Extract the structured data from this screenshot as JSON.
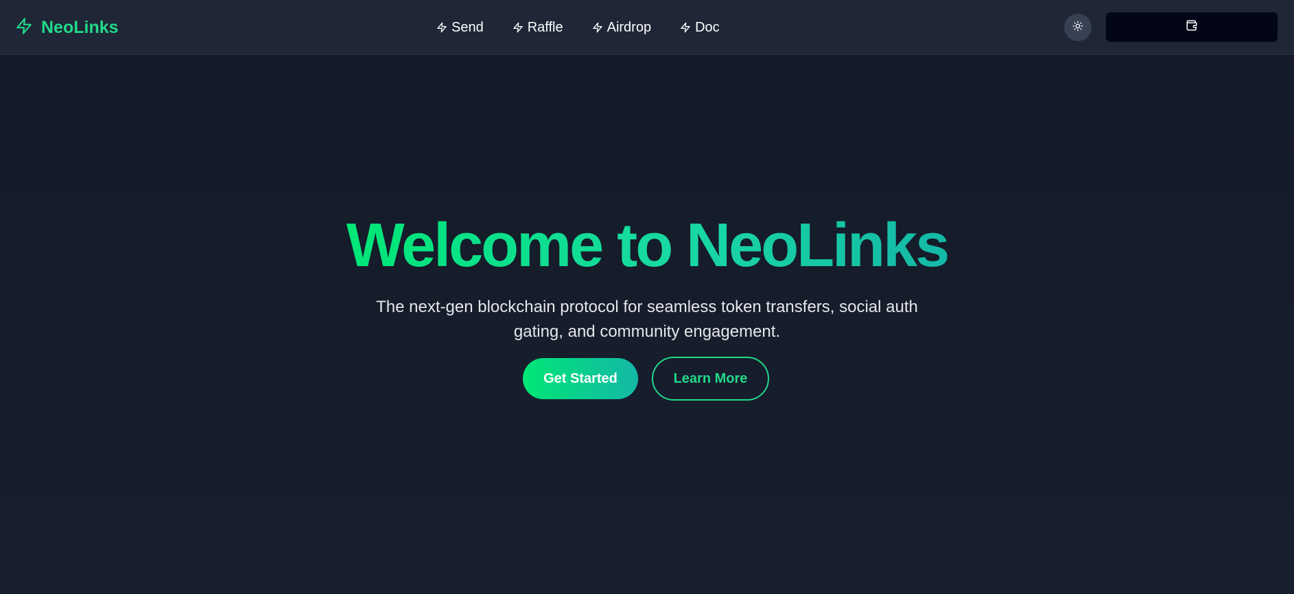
{
  "header": {
    "brand": {
      "name": "NeoLinks",
      "icon": "lightning-bolt-icon"
    },
    "nav": [
      {
        "label": "Send",
        "icon": "lightning-bolt-icon"
      },
      {
        "label": "Raffle",
        "icon": "lightning-bolt-icon"
      },
      {
        "label": "Airdrop",
        "icon": "lightning-bolt-icon"
      },
      {
        "label": "Doc",
        "icon": "lightning-bolt-icon"
      }
    ],
    "theme_toggle": {
      "icon": "sun-icon"
    },
    "wallet_button": {
      "icon": "wallet-icon"
    }
  },
  "hero": {
    "title": "Welcome to NeoLinks",
    "subtitle": "The next-gen blockchain protocol for seamless token transfers, social auth gating, and community engagement.",
    "primary_button": "Get Started",
    "secondary_button": "Learn More"
  },
  "colors": {
    "accent": "#22d98a",
    "gradient_start": "#00e676",
    "gradient_end": "#14b8a6",
    "header_bg": "#1f2736",
    "page_bg": "#151c2a",
    "wallet_button_bg": "#020617"
  }
}
